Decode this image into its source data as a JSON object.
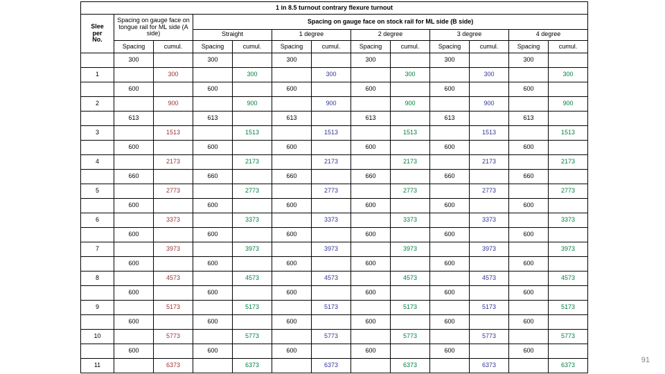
{
  "document": {
    "title": "1 in 8.5 turnout contrary flexure turnout",
    "page_number": "91"
  },
  "colors": {
    "header_bg": "#cc99ff",
    "header_text": "#ffffff",
    "grid_line": "#000000",
    "cumul_a_side": "#993333",
    "cumul_straight": "#008040",
    "cumul_1deg": "#333399",
    "cumul_2deg": "#008040",
    "cumul_3deg": "#333399",
    "cumul_4deg": "#008040",
    "spacing_text": "#000000",
    "page_number_text": "#808080"
  },
  "header": {
    "sleeper_label": "Slee per No.",
    "sleeper_lines": [
      "Slee",
      "per",
      "No."
    ],
    "group_a": "Spacing on gauge face on tongue rail for ML side (A side)",
    "group_b": "Spacing on gauge face on stock rail for ML side (B side)",
    "subgroups": [
      "Straight",
      "1 degree",
      "2 degree",
      "3 degree",
      "4 degree"
    ],
    "col_spacing": "Spacing",
    "col_cumul": "cumul."
  },
  "table": {
    "column_groups": [
      {
        "name": "A side",
        "spacing_header": "Spacing",
        "cumul_header": "cumul.",
        "cumul_color": "#993333"
      },
      {
        "name": "Straight",
        "spacing_header": "Spacing",
        "cumul_header": "cumul.",
        "cumul_color": "#008040"
      },
      {
        "name": "1 degree",
        "spacing_header": "Spacing",
        "cumul_header": "cumul.",
        "cumul_color": "#333399"
      },
      {
        "name": "2 degree",
        "spacing_header": "Spacing",
        "cumul_header": "cumul.",
        "cumul_color": "#008040"
      },
      {
        "name": "3 degree",
        "spacing_header": "Spacing",
        "cumul_header": "cumul.",
        "cumul_color": "#333399"
      },
      {
        "name": "4 degree",
        "spacing_header": "Spacing",
        "cumul_header": "cumul.",
        "cumul_color": "#008040"
      }
    ],
    "rows": [
      {
        "kind": "spacing",
        "sleeper": "",
        "values": [
          "300",
          "300",
          "300",
          "300",
          "300",
          "300"
        ]
      },
      {
        "kind": "cumul",
        "sleeper": "1",
        "values": [
          "300",
          "300",
          "300",
          "300",
          "300",
          "300"
        ]
      },
      {
        "kind": "spacing",
        "sleeper": "",
        "values": [
          "600",
          "600",
          "600",
          "600",
          "600",
          "600"
        ]
      },
      {
        "kind": "cumul",
        "sleeper": "2",
        "values": [
          "900",
          "900",
          "900",
          "900",
          "900",
          "900"
        ]
      },
      {
        "kind": "spacing",
        "sleeper": "",
        "values": [
          "613",
          "613",
          "613",
          "613",
          "613",
          "613"
        ]
      },
      {
        "kind": "cumul",
        "sleeper": "3",
        "values": [
          "1513",
          "1513",
          "1513",
          "1513",
          "1513",
          "1513"
        ]
      },
      {
        "kind": "spacing",
        "sleeper": "",
        "values": [
          "600",
          "600",
          "600",
          "600",
          "600",
          "600"
        ]
      },
      {
        "kind": "cumul",
        "sleeper": "4",
        "values": [
          "2173",
          "2173",
          "2173",
          "2173",
          "2173",
          "2173"
        ]
      },
      {
        "kind": "spacing",
        "sleeper": "",
        "values": [
          "660",
          "660",
          "660",
          "660",
          "660",
          "660"
        ]
      },
      {
        "kind": "cumul",
        "sleeper": "5",
        "values": [
          "2773",
          "2773",
          "2773",
          "2773",
          "2773",
          "2773"
        ]
      },
      {
        "kind": "spacing",
        "sleeper": "",
        "values": [
          "600",
          "600",
          "600",
          "600",
          "600",
          "600"
        ]
      },
      {
        "kind": "cumul",
        "sleeper": "6",
        "values": [
          "3373",
          "3373",
          "3373",
          "3373",
          "3373",
          "3373"
        ]
      },
      {
        "kind": "spacing",
        "sleeper": "",
        "values": [
          "600",
          "600",
          "600",
          "600",
          "600",
          "600"
        ]
      },
      {
        "kind": "cumul",
        "sleeper": "7",
        "values": [
          "3973",
          "3973",
          "3973",
          "3973",
          "3973",
          "3973"
        ]
      },
      {
        "kind": "spacing",
        "sleeper": "",
        "values": [
          "600",
          "600",
          "600",
          "600",
          "600",
          "600"
        ]
      },
      {
        "kind": "cumul",
        "sleeper": "8",
        "values": [
          "4573",
          "4573",
          "4573",
          "4573",
          "4573",
          "4573"
        ]
      },
      {
        "kind": "spacing",
        "sleeper": "",
        "values": [
          "600",
          "600",
          "600",
          "600",
          "600",
          "600"
        ]
      },
      {
        "kind": "cumul",
        "sleeper": "9",
        "values": [
          "5173",
          "5173",
          "5173",
          "5173",
          "5173",
          "5173"
        ]
      },
      {
        "kind": "spacing",
        "sleeper": "",
        "values": [
          "600",
          "600",
          "600",
          "600",
          "600",
          "600"
        ]
      },
      {
        "kind": "cumul",
        "sleeper": "10",
        "values": [
          "5773",
          "5773",
          "5773",
          "5773",
          "5773",
          "5773"
        ]
      },
      {
        "kind": "spacing",
        "sleeper": "",
        "values": [
          "600",
          "600",
          "600",
          "600",
          "600",
          "600"
        ]
      },
      {
        "kind": "cumul",
        "sleeper": "11",
        "values": [
          "6373",
          "6373",
          "6373",
          "6373",
          "6373",
          "6373"
        ]
      }
    ]
  }
}
